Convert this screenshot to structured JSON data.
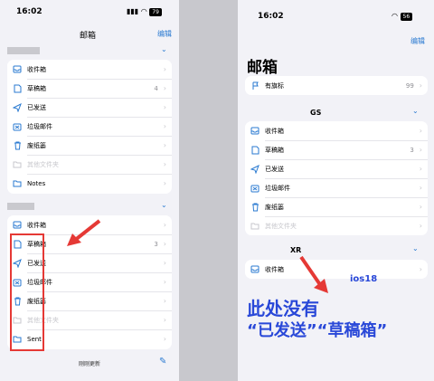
{
  "left": {
    "status_time": "16:02",
    "battery": "79",
    "nav_title": "邮箱",
    "edit": "编辑",
    "section1": {
      "items": [
        {
          "label": "收件箱",
          "count": "",
          "icon": "inbox-icon",
          "dim": false
        },
        {
          "label": "草稿箱",
          "count": "4",
          "icon": "draft-icon",
          "dim": false
        },
        {
          "label": "已发送",
          "count": "",
          "icon": "sent-icon",
          "dim": false
        },
        {
          "label": "垃圾邮件",
          "count": "",
          "icon": "junk-icon",
          "dim": false
        },
        {
          "label": "废纸篓",
          "count": "",
          "icon": "trash-icon",
          "dim": false
        },
        {
          "label": "其他文件夹",
          "count": "",
          "icon": "folder-icon",
          "dim": true
        },
        {
          "label": "Notes",
          "count": "",
          "icon": "folder-icon",
          "dim": false
        }
      ]
    },
    "section2": {
      "items": [
        {
          "label": "收件箱",
          "count": "",
          "icon": "inbox-icon",
          "dim": false
        },
        {
          "label": "草稿箱",
          "count": "3",
          "icon": "draft-icon",
          "dim": false
        },
        {
          "label": "已发送",
          "count": "",
          "icon": "sent-icon",
          "dim": false
        },
        {
          "label": "垃圾邮件",
          "count": "",
          "icon": "junk-icon",
          "dim": false
        },
        {
          "label": "废纸篓",
          "count": "",
          "icon": "trash-icon",
          "dim": false
        },
        {
          "label": "其他文件夹",
          "count": "",
          "icon": "folder-icon",
          "dim": true
        },
        {
          "label": "Sent",
          "count": "",
          "icon": "folder-icon",
          "dim": false
        }
      ]
    },
    "bottom_status": "刚刚更新"
  },
  "right": {
    "status_time": "16:02",
    "battery": "56",
    "edit": "编辑",
    "big_title": "邮箱",
    "flagged": {
      "label": "有旗标",
      "count": "99"
    },
    "section_gs": {
      "header": "GS",
      "items": [
        {
          "label": "收件箱",
          "count": "",
          "icon": "inbox-icon",
          "dim": false
        },
        {
          "label": "草稿箱",
          "count": "3",
          "icon": "draft-icon",
          "dim": false
        },
        {
          "label": "已发送",
          "count": "",
          "icon": "sent-icon",
          "dim": false
        },
        {
          "label": "垃圾邮件",
          "count": "",
          "icon": "junk-icon",
          "dim": false
        },
        {
          "label": "废纸篓",
          "count": "",
          "icon": "trash-icon",
          "dim": false
        },
        {
          "label": "其他文件夹",
          "count": "",
          "icon": "folder-icon",
          "dim": true
        }
      ]
    },
    "section_xr": {
      "header": "XR",
      "items": [
        {
          "label": "收件箱",
          "count": "",
          "icon": "inbox-icon",
          "dim": false
        }
      ]
    },
    "annotation_ios": "ios18",
    "annotation_line1": "此处没有",
    "annotation_line2": "“已发送”“草稿箱”"
  },
  "colors": {
    "accent": "#2a7ad1",
    "red": "#e53935",
    "annotation": "#2948d8"
  }
}
